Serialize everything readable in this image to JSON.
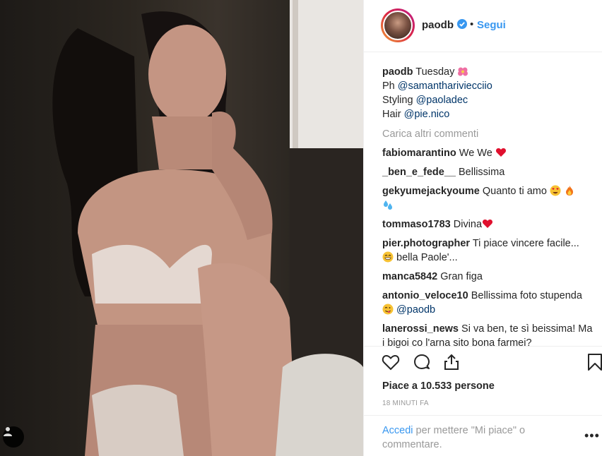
{
  "header": {
    "username": "paodb",
    "separator": "•",
    "follow_label": "Segui"
  },
  "caption": {
    "username": "paodb",
    "line1_text": "Tuesday",
    "line2_prefix": "Ph ",
    "line2_mention": "@samanthariviecciio",
    "line3_prefix": "Styling ",
    "line3_mention": "@paoladec",
    "line4_prefix": "Hair ",
    "line4_mention": "@pie.nico"
  },
  "load_more": "Carica altri commenti",
  "comments": [
    {
      "user": "fabiomarantino",
      "text": "We We"
    },
    {
      "user": "_ben_e_fede__",
      "text": "Bellissima"
    },
    {
      "user": "gekyumejackyoume",
      "text": "Quanto ti amo"
    },
    {
      "user": "tommaso1783",
      "text": "Divina"
    },
    {
      "user": "pier.photographer",
      "text": "Ti piace vincere facile...",
      "text2": "bella Paole'..."
    },
    {
      "user": "manca5842",
      "text": "Gran figa"
    },
    {
      "user": "antonio_veloce10",
      "text": "Bellissima foto stupenda",
      "mention": "@paodb"
    },
    {
      "user": "lanerossi_news",
      "text": "Si va ben, te sì beissima! Ma i bigoi co l'arna sito bona farmei?"
    }
  ],
  "likes": "Piace a 10.533 persone",
  "timestamp": "18 MINUTI FA",
  "footer": {
    "login_link": "Accedi",
    "login_text": " per mettere \"Mi piace\" o commentare.",
    "more_label": "•••"
  },
  "icons": [
    "heart-icon",
    "comment-icon",
    "share-icon",
    "bookmark-icon",
    "user-tag-icon",
    "verified-badge-icon"
  ],
  "colors": {
    "link": "#003569",
    "accent": "#3897f0",
    "muted": "#999999"
  }
}
